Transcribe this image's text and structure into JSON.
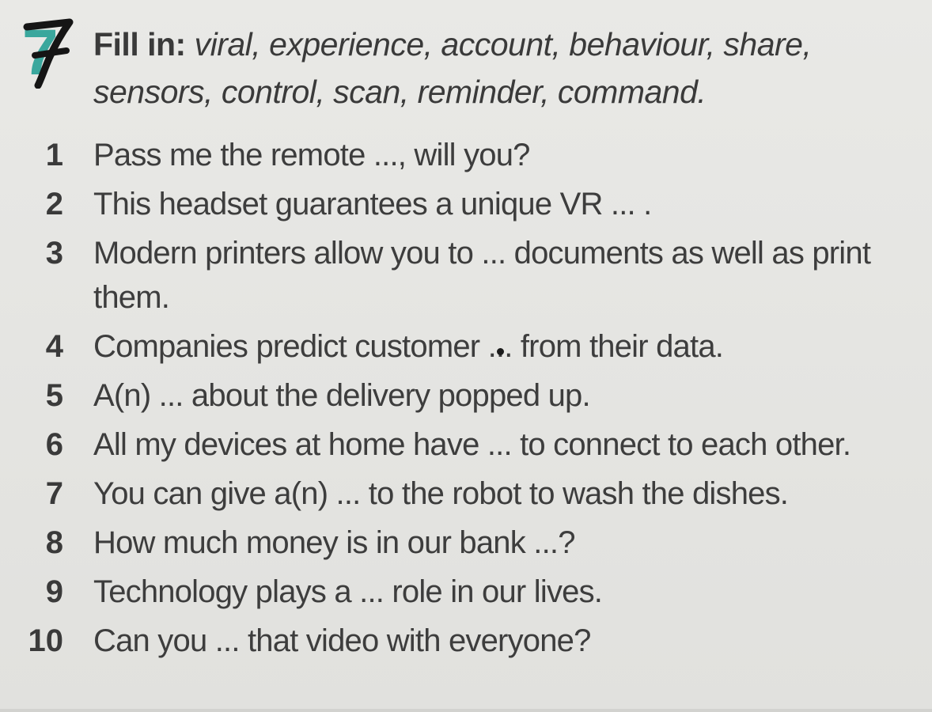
{
  "exercise": {
    "number": "7"
  },
  "instruction": {
    "lead": "Fill in:",
    "words": "viral, experience, account, behaviour, share, sensors, control, scan, reminder, command."
  },
  "items": [
    {
      "num": "1",
      "text": "Pass me the remote ..., will you?"
    },
    {
      "num": "2",
      "text": "This headset guarantees a unique VR ... ."
    },
    {
      "num": "3",
      "text": "Modern printers allow you to ... documents as well as print them."
    },
    {
      "num": "4",
      "text": "Companies predict customer ... from their data."
    },
    {
      "num": "5",
      "text": "A(n) ... about the delivery popped up."
    },
    {
      "num": "6",
      "text": "All my devices at home have ... to connect to each other."
    },
    {
      "num": "7",
      "text": "You can give a(n) ... to the robot to wash the dishes."
    },
    {
      "num": "8",
      "text": "How much money is in our bank ...?"
    },
    {
      "num": "9",
      "text": "Technology plays a ... role in our lives."
    },
    {
      "num": "10",
      "text": "Can you ... that video with everyone?"
    }
  ]
}
